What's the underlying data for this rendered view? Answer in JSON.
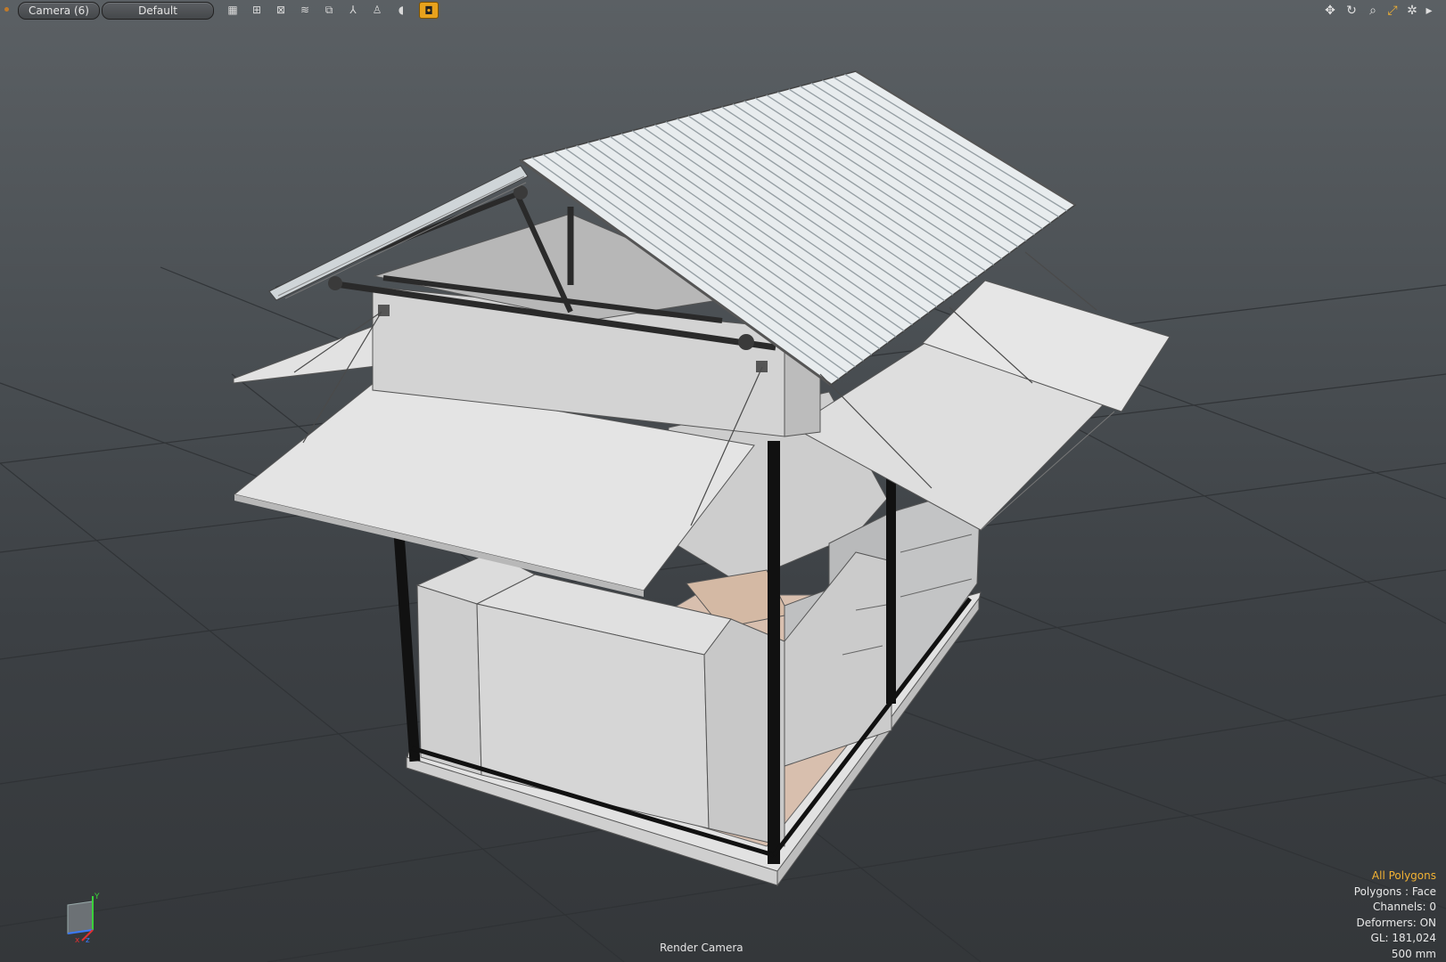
{
  "toolbar": {
    "camera_dropdown": "Camera (6)",
    "style_dropdown": "Default",
    "tool_icons": [
      "wireframe-grid-icon",
      "quad-grid-icon",
      "cross-box-icon",
      "hair-icon",
      "frame-icon",
      "axis-icon",
      "person-icon",
      "shadow-icon",
      "texture-icon"
    ],
    "right_icons": [
      "move-icon",
      "rotate-icon",
      "zoom-icon",
      "fit-icon",
      "settings-icon",
      "expand-arrow-icon"
    ]
  },
  "accent_color": "#e8a21d",
  "info_panel": {
    "selection": "All Polygons",
    "polygons": "Polygons : Face",
    "channels": "Channels: 0",
    "deformers": "Deformers: ON",
    "gl": "GL: 181,024",
    "scale": "500 mm"
  },
  "bottom": {
    "camera_label": "Render Camera"
  },
  "axis": {
    "x": "x",
    "y": "Y",
    "z": "z"
  }
}
